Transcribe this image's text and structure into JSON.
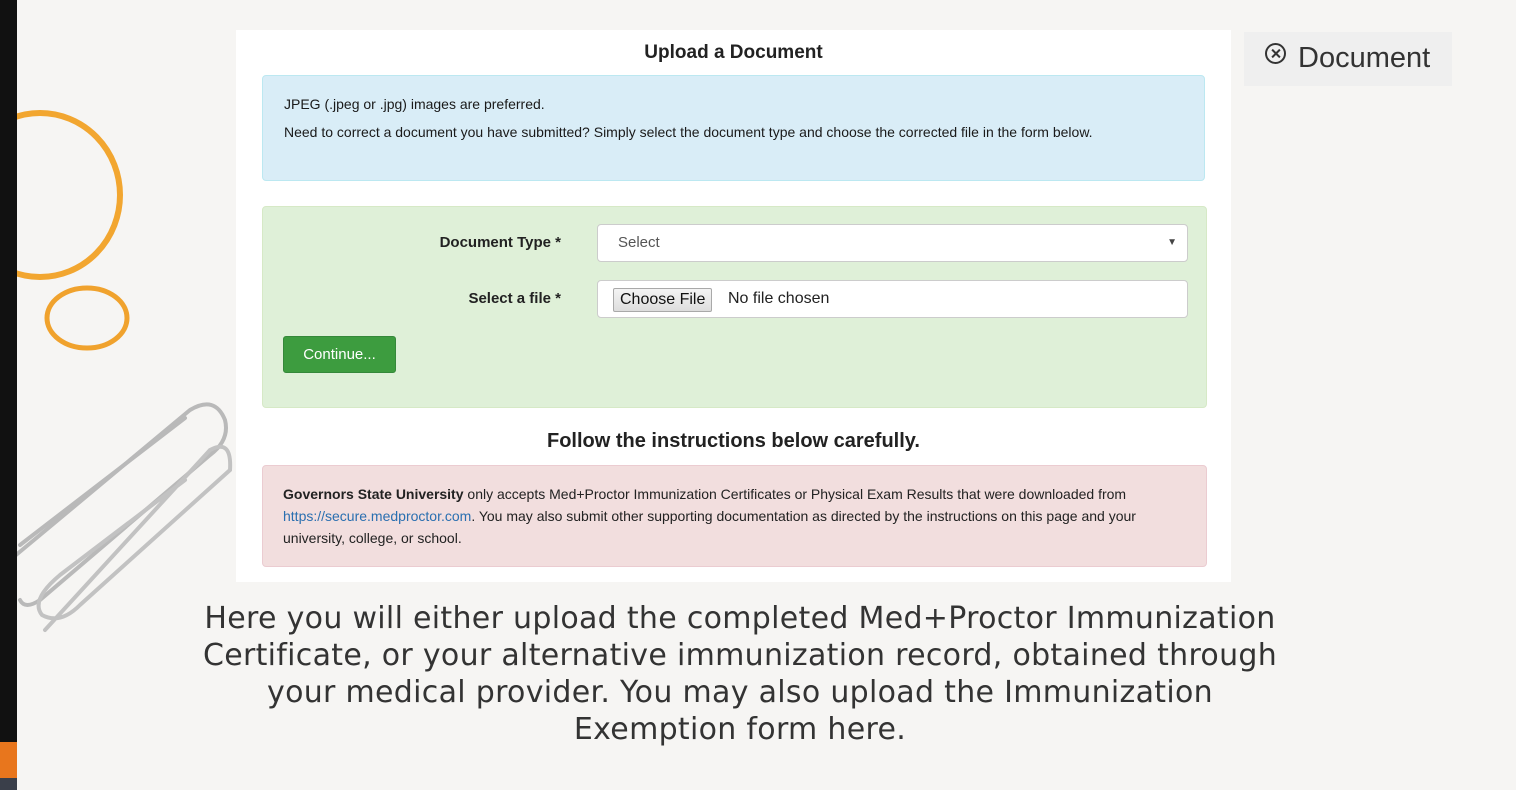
{
  "panel": {
    "title": "Upload a Document",
    "info": {
      "line1": "JPEG (.jpeg or .jpg) images are preferred.",
      "line2": "Need to correct a document you have submitted? Simply select the document type and choose the corrected file in the form below."
    },
    "form": {
      "document_type_label": "Document Type *",
      "document_type_value": "Select",
      "select_file_label": "Select a file *",
      "choose_file_label": "Choose File",
      "no_file_text": "No file chosen",
      "continue_label": "Continue..."
    },
    "instructions_heading": "Follow the instructions below carefully.",
    "warning": {
      "org": "Governors State University",
      "text_part1": " only accepts Med+Proctor Immunization Certificates or Physical Exam Results that were downloaded from ",
      "link": "https://secure.medproctor.com",
      "text_part2": ". You may also submit other supporting documentation as directed by the instructions on this page and your university, college, or school."
    }
  },
  "doc_tab": {
    "label": "Document",
    "icon": "close-circle-icon"
  },
  "caption": "Here you will either upload the completed Med+Proctor Immunization Certificate, or your alternative immunization record, obtained through your medical provider. You may also upload the Immunization Exemption form here.",
  "colors": {
    "info_bg": "#d9edf7",
    "form_bg": "#dff0d8",
    "warning_bg": "#f2dede",
    "continue_btn": "#3d9c3f",
    "link": "#2a6fb0",
    "rubber_band": "#f2a630"
  }
}
